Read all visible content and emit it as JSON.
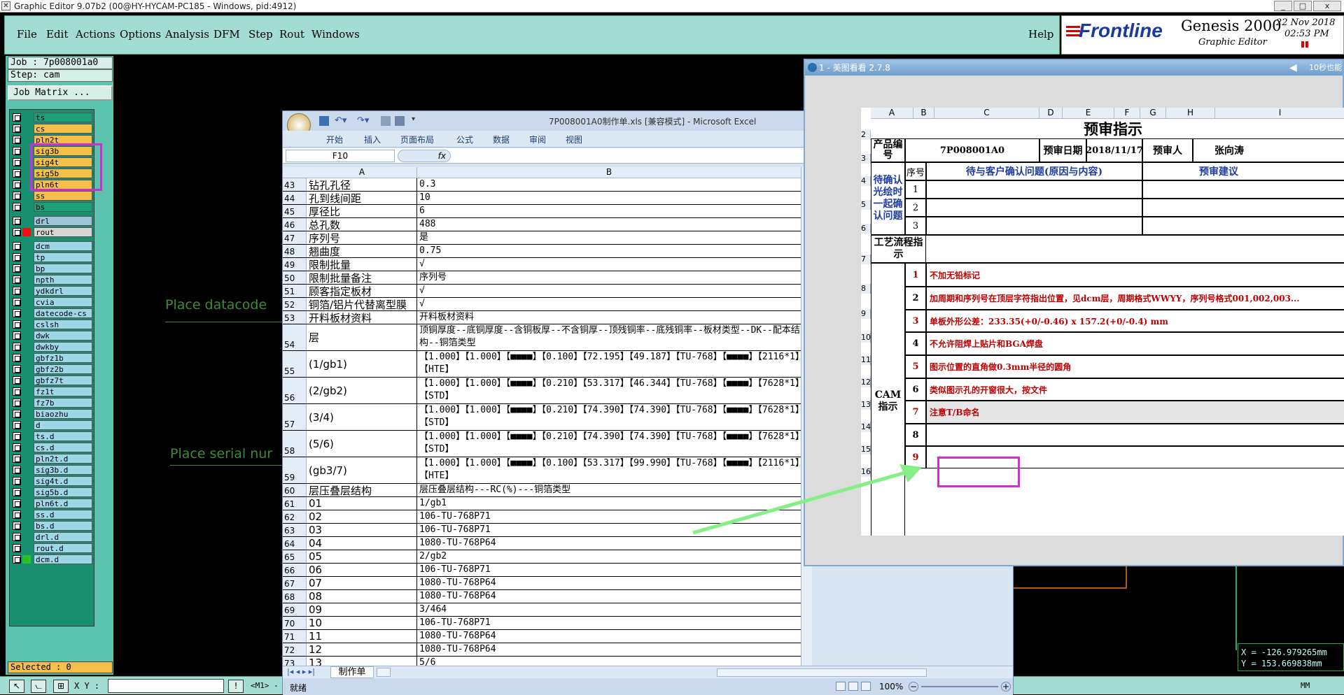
{
  "window": {
    "title": "Graphic Editor 9.07b2 (00@HY-HYCAM-PC185 - Windows, pid:4912)",
    "min": "_",
    "max": "□",
    "close": "x"
  },
  "menu": {
    "items": [
      "File",
      "Edit",
      "Actions",
      "Options",
      "Analysis",
      "DFM",
      "Step",
      "Rout",
      "Windows"
    ],
    "help": "Help"
  },
  "logo": {
    "brand": "Frontline",
    "product": "Genesis 2000",
    "sub": "Graphic Editor",
    "date": "22 Nov 2018",
    "time": "02:53 PM"
  },
  "job": {
    "job": "Job : 7p008001a0",
    "step": "Step: cam",
    "matrix_btn": "Job Matrix ..."
  },
  "layers": [
    {
      "name": "ts",
      "color": "#1a9f78"
    },
    {
      "name": "cs",
      "color": "#f4c04a"
    },
    {
      "name": "pln2t",
      "color": "#f4c04a"
    },
    {
      "name": "sig3b",
      "color": "#f4c04a"
    },
    {
      "name": "sig4t",
      "color": "#f4c04a"
    },
    {
      "name": "sig5b",
      "color": "#f4c04a"
    },
    {
      "name": "pln6t",
      "color": "#f4c04a"
    },
    {
      "name": "ss",
      "color": "#f4c04a"
    },
    {
      "name": "bs",
      "color": "#1a9f78"
    },
    {
      "name": "drl",
      "color": "#9ec4d8"
    },
    {
      "name": "rout",
      "color": "#d6d6d6"
    },
    {
      "name": "dcm",
      "color": "#9ed8e8"
    },
    {
      "name": "tp",
      "color": "#9ed8e8"
    },
    {
      "name": "bp",
      "color": "#9ed8e8"
    },
    {
      "name": "npth",
      "color": "#9ed8e8"
    },
    {
      "name": "ydkdrl",
      "color": "#9ed8e8"
    },
    {
      "name": "cvia",
      "color": "#9ed8e8"
    },
    {
      "name": "datecode-cs",
      "color": "#9ed8e8"
    },
    {
      "name": "cslsh",
      "color": "#9ed8e8"
    },
    {
      "name": "dwk",
      "color": "#9ed8e8"
    },
    {
      "name": "dwkby",
      "color": "#9ed8e8"
    },
    {
      "name": "gbfz1b",
      "color": "#9ed8e8"
    },
    {
      "name": "gbfz2b",
      "color": "#9ed8e8"
    },
    {
      "name": "gbfz7t",
      "color": "#9ed8e8"
    },
    {
      "name": "fz1t",
      "color": "#9ed8e8"
    },
    {
      "name": "fz7b",
      "color": "#9ed8e8"
    },
    {
      "name": "biaozhu",
      "color": "#9ed8e8"
    },
    {
      "name": "d",
      "color": "#9ed8e8"
    },
    {
      "name": "ts.d",
      "color": "#9ed8e8"
    },
    {
      "name": "cs.d",
      "color": "#9ed8e8"
    },
    {
      "name": "pln2t.d",
      "color": "#9ed8e8"
    },
    {
      "name": "sig3b.d",
      "color": "#9ed8e8"
    },
    {
      "name": "sig4t.d",
      "color": "#9ed8e8"
    },
    {
      "name": "sig5b.d",
      "color": "#9ed8e8"
    },
    {
      "name": "pln6t.d",
      "color": "#9ed8e8"
    },
    {
      "name": "ss.d",
      "color": "#9ed8e8"
    },
    {
      "name": "bs.d",
      "color": "#9ed8e8"
    },
    {
      "name": "drl.d",
      "color": "#9ed8e8"
    },
    {
      "name": "rout.d",
      "color": "#9ed8e8"
    },
    {
      "name": "dcm.d",
      "color": "#9ed8e8"
    }
  ],
  "selected": "Selected : 0",
  "canvas": {
    "text1": "Place datacode",
    "text2": "Place serial nur"
  },
  "coords": {
    "x": "X = -126.979265mm",
    "y": "Y = 153.669838mm",
    "unit": "MM"
  },
  "bottom": {
    "xy_label": "X Y :",
    "excl": "!",
    "m1": "<M1> -"
  },
  "excel": {
    "title": "7P008001A0制作单.xls  [兼容模式] - Microsoft Excel",
    "tabs": [
      "开始",
      "插入",
      "页面布局",
      "公式",
      "数据",
      "审阅",
      "视图"
    ],
    "namebox": "F10",
    "fx": "fx",
    "colA": "A",
    "colB": "B",
    "sheet": "制作单",
    "status": "就绪",
    "zoom": "100%",
    "rows": [
      {
        "n": "43",
        "a": "钻孔孔径",
        "b": "0.3"
      },
      {
        "n": "44",
        "a": "孔到线间距",
        "b": "10"
      },
      {
        "n": "45",
        "a": "厚径比",
        "b": "6"
      },
      {
        "n": "46",
        "a": "总孔数",
        "b": "488"
      },
      {
        "n": "47",
        "a": "序列号",
        "b": "是"
      },
      {
        "n": "48",
        "a": "翘曲度",
        "b": "0.75"
      },
      {
        "n": "49",
        "a": "限制批量",
        "b": "√"
      },
      {
        "n": "50",
        "a": "限制批量备注",
        "b": "序列号"
      },
      {
        "n": "51",
        "a": "顾客指定板材",
        "b": "√"
      },
      {
        "n": "52",
        "a": "铜箔/铝片代替离型膜",
        "b": "√"
      },
      {
        "n": "53",
        "a": "开料板材资料",
        "b": "开料板材资料"
      },
      {
        "n": "54",
        "a": "层",
        "b": "顶铜厚度--底铜厚度--含铜板厚--不含铜厚--顶残铜率--底残铜率--板材类型--DK--配本结构--铜箔类型"
      },
      {
        "n": "55",
        "a": "(1/gb1)",
        "b": "【1.000】【1.000】【■■■■】【0.100】【72.195】【49.187】【TU-768】【■■■■】【2116*1】【HTE】"
      },
      {
        "n": "56",
        "a": "(2/gb2)",
        "b": "【1.000】【1.000】【■■■■】【0.210】【53.317】【46.344】【TU-768】【■■■■】【7628*1】【STD】"
      },
      {
        "n": "57",
        "a": "(3/4)",
        "b": "【1.000】【1.000】【■■■■】【0.210】【74.390】【74.390】【TU-768】【■■■■】【7628*1】【STD】"
      },
      {
        "n": "58",
        "a": "(5/6)",
        "b": "【1.000】【1.000】【■■■■】【0.210】【74.390】【74.390】【TU-768】【■■■■】【7628*1】【STD】"
      },
      {
        "n": "59",
        "a": "(gb3/7)",
        "b": "【1.000】【1.000】【■■■■】【0.100】【53.317】【99.990】【TU-768】【■■■■】【2116*1】【HTE】"
      },
      {
        "n": "60",
        "a": "层压叠层结构",
        "b": "层压叠层结构---RC(%)---铜箔类型"
      },
      {
        "n": "61",
        "a": "01",
        "b": "1/gb1"
      },
      {
        "n": "62",
        "a": "02",
        "b": "106-TU-768P71"
      },
      {
        "n": "63",
        "a": "03",
        "b": "106-TU-768P71"
      },
      {
        "n": "64",
        "a": "04",
        "b": "1080-TU-768P64"
      },
      {
        "n": "65",
        "a": "05",
        "b": "2/gb2"
      },
      {
        "n": "66",
        "a": "06",
        "b": "106-TU-768P71"
      },
      {
        "n": "67",
        "a": "07",
        "b": "1080-TU-768P64"
      },
      {
        "n": "68",
        "a": "08",
        "b": "1080-TU-768P64"
      },
      {
        "n": "69",
        "a": "09",
        "b": "3/464"
      },
      {
        "n": "70",
        "a": "10",
        "b": "106-TU-768P71"
      },
      {
        "n": "71",
        "a": "11",
        "b": "1080-TU-768P64"
      },
      {
        "n": "72",
        "a": "12",
        "b": "1080-TU-768P64"
      },
      {
        "n": "73",
        "a": "13",
        "b": "5/6"
      }
    ]
  },
  "viewer": {
    "title": "1 - 美图看看 2.7.8",
    "right": "10秒也能",
    "cols": [
      "A",
      "B",
      "C",
      "D",
      "E",
      "F",
      "G",
      "H",
      "I"
    ],
    "sheet_title": "预审指示",
    "product_no_label": "产品编号",
    "product_no": "7P008001A0",
    "date_label": "预审日期",
    "date": "2018/11/17",
    "person_label": "预审人",
    "person": "张向涛",
    "seq_label": "序号",
    "question_label": "待与客户确认问题(原因与内容)",
    "suggest_label": "预审建议",
    "confirm_label": "待确认光绘时一起确认问题",
    "process_label": "工艺流程指示",
    "cam_label": "CAM指示",
    "confirm_nums": [
      "1",
      "2",
      "3"
    ],
    "cam_items": [
      {
        "n": "1",
        "t": "不加无铅标记"
      },
      {
        "n": "2",
        "t": "加周期和序列号在顶层字符指出位置，见dcm层，周期格式WWYY，序列号格式001,002,003..."
      },
      {
        "n": "3",
        "t": "单板外形公差：233.35(+0/-0.46) x 157.2(+0/-0.4) mm"
      },
      {
        "n": "4",
        "t": "不允许阻焊上贴片和BGA焊盘"
      },
      {
        "n": "5",
        "t": "图示位置的直角做0.3mm半径的圆角"
      },
      {
        "n": "6",
        "t": "类似图示孔的开窗很大，按文件"
      },
      {
        "n": "7",
        "t": "注意T/B命名"
      },
      {
        "n": "8",
        "t": ""
      },
      {
        "n": "9",
        "t": ""
      }
    ],
    "row_nums": [
      "2",
      "3",
      "4",
      "5",
      "6",
      "7",
      "8",
      "9",
      "10",
      "11",
      "12",
      "13",
      "14",
      "15",
      "16"
    ]
  }
}
